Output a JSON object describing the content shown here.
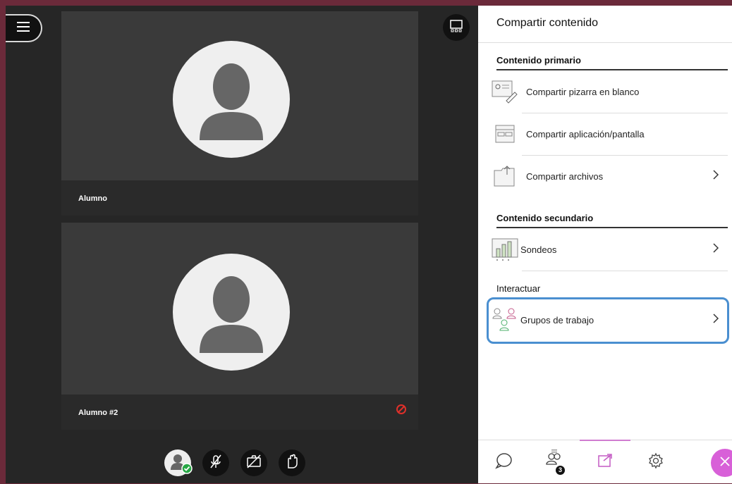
{
  "stage": {
    "tiles": [
      {
        "name": "Alumno",
        "muted_indicator": false
      },
      {
        "name": "Alumno #2",
        "muted_indicator": true
      }
    ],
    "controls": [
      {
        "name": "me-avatar"
      },
      {
        "name": "microphone-muted"
      },
      {
        "name": "camera-off"
      },
      {
        "name": "raise-hand"
      }
    ],
    "badge_color": "#27a845",
    "alert_color": "#e0302a"
  },
  "panel": {
    "title": "Compartir contenido",
    "sections": {
      "primary": "Contenido primario",
      "secondary": "Contenido secundario",
      "interact": "Interactuar"
    },
    "items": {
      "whiteboard": "Compartir pizarra en blanco",
      "app_screen": "Compartir aplicación/pantalla",
      "files": "Compartir archivos",
      "polls": "Sondeos",
      "breakout": "Grupos de trabajo"
    },
    "tabs": {
      "attendees_count": "3"
    },
    "highlight_color": "#4a8fd0",
    "accent_color": "#d860d8"
  }
}
